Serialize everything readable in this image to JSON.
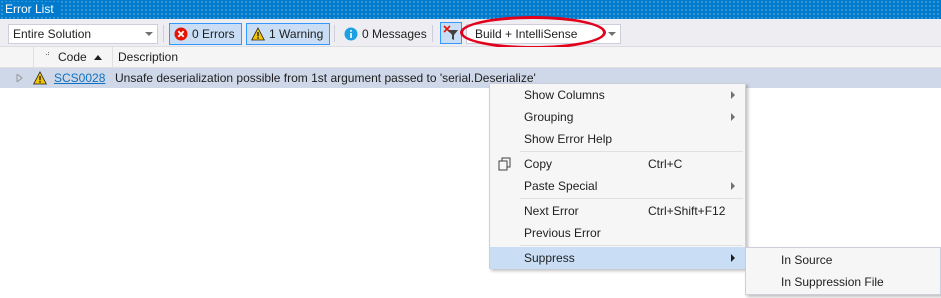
{
  "window": {
    "title": "Error List"
  },
  "toolbar": {
    "scope": "Entire Solution",
    "errors_label": "0 Errors",
    "warnings_label": "1 Warning",
    "messages_label": "0 Messages",
    "build_source": "Build + IntelliSense"
  },
  "columns": {
    "code": "Code",
    "description": "Description"
  },
  "rows": [
    {
      "code": "SCS0028",
      "description": "Unsafe deserialization possible from 1st argument passed to 'serial.Deserialize'"
    }
  ],
  "context_menu": {
    "items": [
      {
        "label": "Show Columns",
        "shortcut": "",
        "submenu": true
      },
      {
        "label": "Grouping",
        "shortcut": "",
        "submenu": true
      },
      {
        "label": "Show Error Help",
        "shortcut": "",
        "submenu": false
      },
      {
        "label": "Copy",
        "shortcut": "Ctrl+C",
        "submenu": false
      },
      {
        "label": "Paste Special",
        "shortcut": "",
        "submenu": true
      },
      {
        "label": "Next Error",
        "shortcut": "Ctrl+Shift+F12",
        "submenu": false
      },
      {
        "label": "Previous Error",
        "shortcut": "",
        "submenu": false
      },
      {
        "label": "Suppress",
        "shortcut": "",
        "submenu": true,
        "highlighted": true
      }
    ]
  },
  "suppress_submenu": {
    "items": [
      "In Source",
      "In Suppression File"
    ]
  },
  "colors": {
    "titlebar": "#007acc",
    "selection": "#c9def5",
    "row_highlight": "#cfd8e8",
    "annotation_oval": "#e3001b",
    "link": "#0e70c0"
  }
}
